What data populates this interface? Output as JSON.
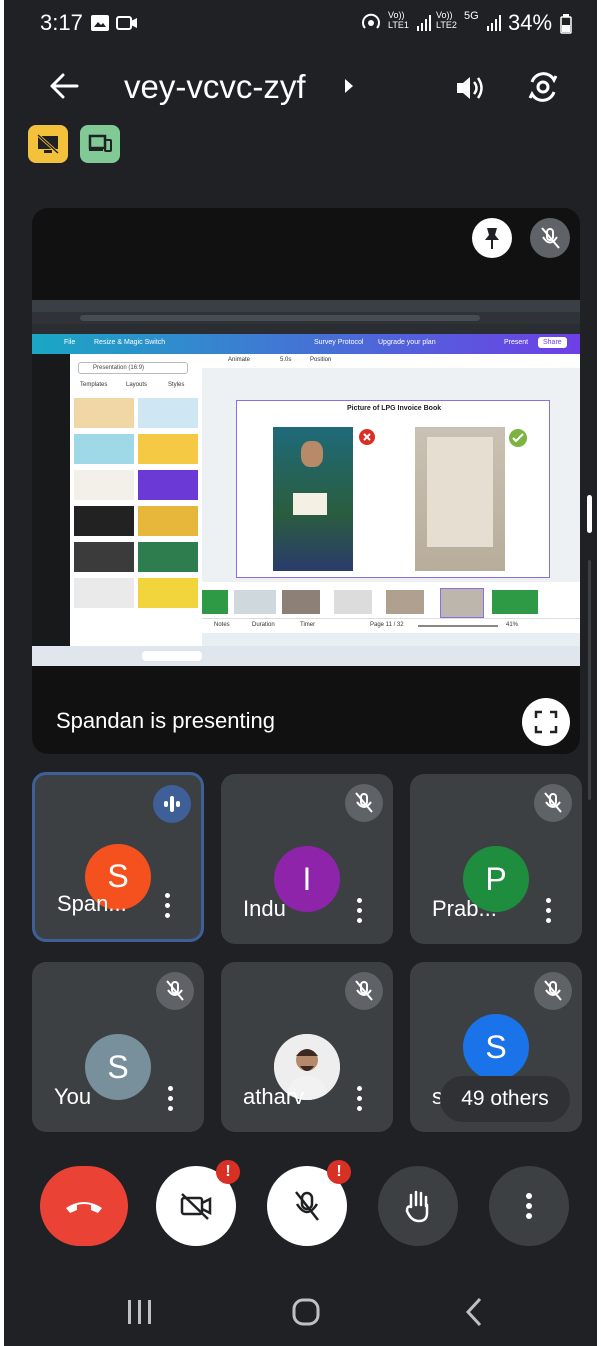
{
  "status_bar": {
    "time": "3:17",
    "battery": "34%",
    "net1": "Vo)) LTE1",
    "net2": "Vo)) LTE2",
    "fiveg": "5G"
  },
  "header": {
    "meeting_code": "vey-vcvc-zyf"
  },
  "presentation": {
    "presenter_text": "Spandan is presenting",
    "slide_title": "Picture of LPG Invoice Book",
    "app_toolbar": {
      "file": "File",
      "resize": "Resize & Magic Switch",
      "title": "Survey Protocol",
      "upgrade": "Upgrade your plan",
      "present": "Present",
      "share": "Share"
    },
    "panel": {
      "search": "Presentation (16:9)",
      "tabs": [
        "Templates",
        "Layouts",
        "Styles"
      ]
    },
    "editor": {
      "animate": "Animate",
      "time": "5.0s",
      "position": "Position",
      "notes": "Notes",
      "duration": "Duration",
      "timer": "Timer",
      "page": "Page 11 / 32",
      "zoom": "41%"
    }
  },
  "participants": [
    {
      "name": "Span...",
      "initial": "S",
      "color": "#f4511e",
      "speaking": true
    },
    {
      "name": "Indu",
      "initial": "I",
      "color": "#8e24aa",
      "speaking": false
    },
    {
      "name": "Prab...",
      "initial": "P",
      "color": "#1e8e3e",
      "speaking": false
    },
    {
      "name": "You",
      "initial": "S",
      "color": "#78909c",
      "speaking": false
    },
    {
      "name": "atharv",
      "initial": "",
      "color": "#e0e0e0",
      "speaking": false
    },
    {
      "name": "su",
      "initial": "S",
      "color": "#1a73e8",
      "speaking": false
    }
  ],
  "others_label": "49 others",
  "colors": {
    "background": "#202124",
    "tile": "#3c4043",
    "end_call": "#ea4335",
    "accent": "#3f5f99"
  }
}
